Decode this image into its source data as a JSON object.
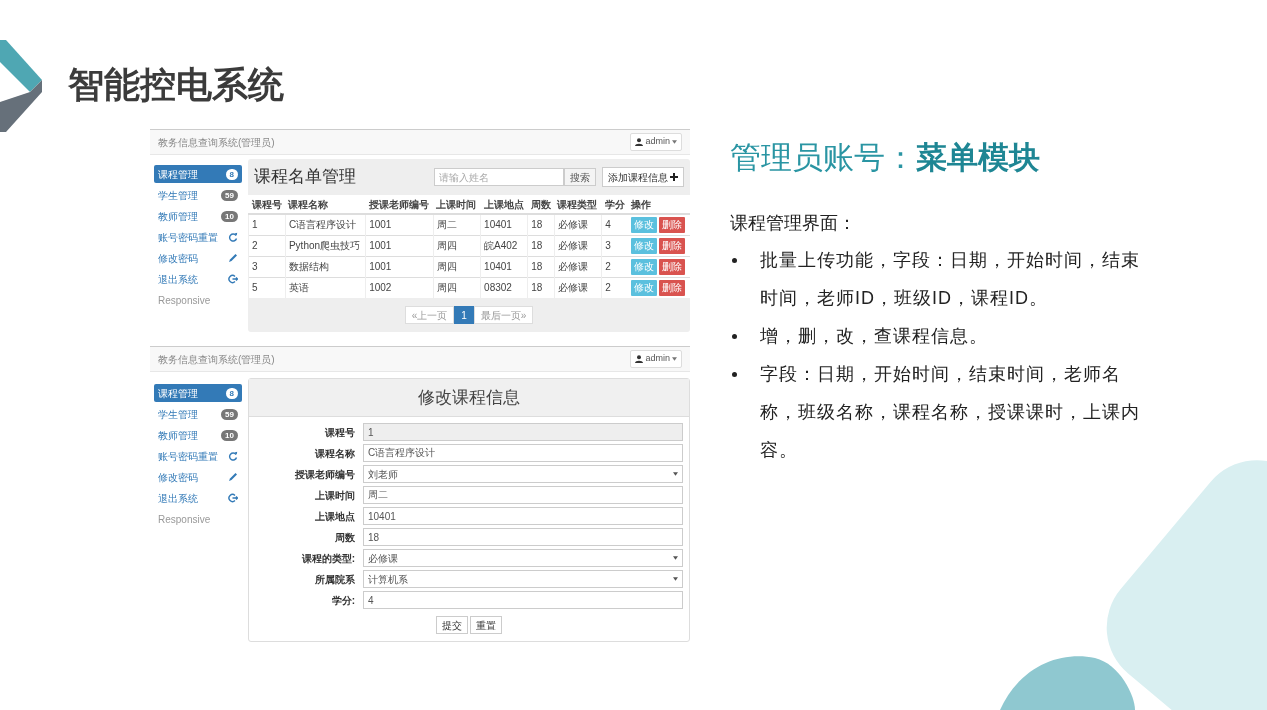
{
  "slide": {
    "title": "智能控电系统"
  },
  "list_screenshot": {
    "brand": "教务信息查询系统(管理员)",
    "user": "admin",
    "sidebar": [
      {
        "label": "课程管理",
        "kind": "badge",
        "badge": "8",
        "selected": true
      },
      {
        "label": "学生管理",
        "kind": "badge",
        "badge": "59",
        "selected": false
      },
      {
        "label": "教师管理",
        "kind": "badge",
        "badge": "10",
        "selected": false
      },
      {
        "label": "账号密码重置",
        "kind": "icon",
        "selected": false
      },
      {
        "label": "修改密码",
        "kind": "icon",
        "selected": false
      },
      {
        "label": "退出系统",
        "kind": "icon",
        "selected": false
      },
      {
        "label": "Responsive",
        "kind": "plain",
        "selected": false
      }
    ],
    "heading": "课程名单管理",
    "search": {
      "placeholder": "请输入姓名",
      "button": "搜索"
    },
    "add_button": "添加课程信息",
    "table": {
      "columns": [
        "课程号",
        "课程名称",
        "授课老师编号",
        "上课时间",
        "上课地点",
        "周数",
        "课程类型",
        "学分",
        "操作"
      ],
      "rows": [
        {
          "cells": [
            "1",
            "C语言程序设计",
            "1001",
            "周二",
            "10401",
            "18",
            "必修课",
            "4"
          ],
          "actions": [
            "修改",
            "删除"
          ]
        },
        {
          "cells": [
            "2",
            "Python爬虫技巧",
            "1001",
            "周四",
            "皖A402",
            "18",
            "必修课",
            "3"
          ],
          "actions": [
            "修改",
            "删除"
          ]
        },
        {
          "cells": [
            "3",
            "数据结构",
            "1001",
            "周四",
            "10401",
            "18",
            "必修课",
            "2"
          ],
          "actions": [
            "修改",
            "删除"
          ]
        },
        {
          "cells": [
            "5",
            "英语",
            "1002",
            "周四",
            "08302",
            "18",
            "必修课",
            "2"
          ],
          "actions": [
            "修改",
            "删除"
          ]
        }
      ]
    },
    "pagination": [
      {
        "label": "«上一页",
        "selected": false
      },
      {
        "label": "1",
        "selected": true
      },
      {
        "label": "最后一页»",
        "selected": false
      }
    ]
  },
  "edit_screenshot": {
    "brand": "教务信息查询系统(管理员)",
    "user": "admin",
    "sidebar": [
      {
        "label": "课程管理",
        "kind": "badge",
        "badge": "8",
        "selected": true
      },
      {
        "label": "学生管理",
        "kind": "badge",
        "badge": "59",
        "selected": false
      },
      {
        "label": "教师管理",
        "kind": "badge",
        "badge": "10",
        "selected": false
      },
      {
        "label": "账号密码重置",
        "kind": "icon",
        "selected": false
      },
      {
        "label": "修改密码",
        "kind": "icon",
        "selected": false
      },
      {
        "label": "退出系统",
        "kind": "icon",
        "selected": false
      },
      {
        "label": "Responsive",
        "kind": "plain",
        "selected": false
      }
    ],
    "heading": "修改课程信息",
    "fields": [
      {
        "label": "课程号",
        "value": "1",
        "kind": "text",
        "disabled": true
      },
      {
        "label": "课程名称",
        "value": "C语言程序设计",
        "kind": "text",
        "disabled": false
      },
      {
        "label": "授课老师编号",
        "value": "刘老师",
        "kind": "select",
        "disabled": false
      },
      {
        "label": "上课时间",
        "value": "周二",
        "kind": "text",
        "disabled": false
      },
      {
        "label": "上课地点",
        "value": "10401",
        "kind": "text",
        "disabled": false
      },
      {
        "label": "周数",
        "value": "18",
        "kind": "text",
        "disabled": false
      },
      {
        "label": "课程的类型:",
        "value": "必修课",
        "kind": "select",
        "disabled": false
      },
      {
        "label": "所属院系",
        "value": "计算机系",
        "kind": "select",
        "disabled": false
      },
      {
        "label": "学分:",
        "value": "4",
        "kind": "text",
        "disabled": false
      }
    ],
    "buttons": [
      "提交",
      "重置"
    ]
  },
  "text_panel": {
    "heading": "管理员账号：**菜单模块**",
    "intro": "课程管理界面：",
    "bullets": [
      "批量上传功能，字段：日期，开始时间，结束时间，老师ID，班级ID，课程ID。",
      "增，删，改，查课程信息。",
      "字段：日期，开始时间，结束时间，老师名称，班级名称，课程名称，授课课时，上课内容。"
    ]
  }
}
